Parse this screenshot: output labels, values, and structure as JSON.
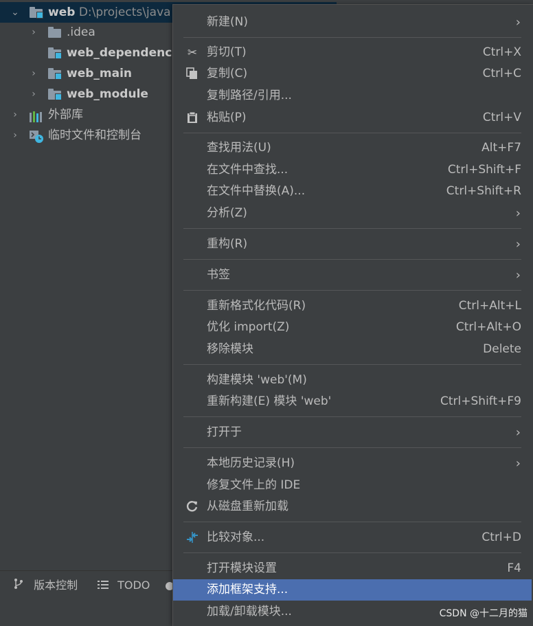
{
  "tree": {
    "root": {
      "name": "web",
      "path": "D:\\projects\\java"
    },
    "items": [
      {
        "label": ".idea"
      },
      {
        "label": "web_dependencie"
      },
      {
        "label": "web_main"
      },
      {
        "label": "web_module"
      },
      {
        "label": "外部库"
      },
      {
        "label": "临时文件和控制台"
      }
    ]
  },
  "bottombar": {
    "tabs": [
      {
        "label": "版本控制"
      },
      {
        "label": "TODO"
      }
    ]
  },
  "menu": {
    "items": [
      {
        "label": "新建(N)",
        "submenu": true
      },
      {
        "label": "剪切(T)",
        "shortcut": "Ctrl+X",
        "icon": "scissors-icon"
      },
      {
        "label": "复制(C)",
        "shortcut": "Ctrl+C",
        "icon": "copy-icon"
      },
      {
        "label": "复制路径/引用..."
      },
      {
        "label": "粘贴(P)",
        "shortcut": "Ctrl+V",
        "icon": "paste-icon"
      },
      {
        "label": "查找用法(U)",
        "shortcut": "Alt+F7"
      },
      {
        "label": "在文件中查找...",
        "shortcut": "Ctrl+Shift+F"
      },
      {
        "label": "在文件中替换(A)...",
        "shortcut": "Ctrl+Shift+R"
      },
      {
        "label": "分析(Z)",
        "submenu": true
      },
      {
        "label": "重构(R)",
        "submenu": true
      },
      {
        "label": "书签",
        "submenu": true
      },
      {
        "label": "重新格式化代码(R)",
        "shortcut": "Ctrl+Alt+L"
      },
      {
        "label": "优化 import(Z)",
        "shortcut": "Ctrl+Alt+O"
      },
      {
        "label": "移除模块",
        "shortcut": "Delete"
      },
      {
        "label": "构建模块 'web'(M)"
      },
      {
        "label": "重新构建(E) 模块 'web'",
        "shortcut": "Ctrl+Shift+F9"
      },
      {
        "label": "打开于",
        "submenu": true
      },
      {
        "label": "本地历史记录(H)",
        "submenu": true
      },
      {
        "label": "修复文件上的 IDE"
      },
      {
        "label": "从磁盘重新加载",
        "icon": "reload-icon"
      },
      {
        "label": "比较对象...",
        "shortcut": "Ctrl+D",
        "icon": "compare-icon"
      },
      {
        "label": "打开模块设置",
        "shortcut": "F4"
      },
      {
        "label": "添加框架支持...",
        "highlighted": true
      },
      {
        "label": "加载/卸载模块..."
      }
    ]
  },
  "watermark": "CSDN @十二月的猫",
  "colors": {
    "background": "#3c3f41",
    "highlight": "#4b6eaf",
    "selected_row": "#0d293e",
    "module_accent": "#40b6e0",
    "compare_icon": "#3592c4"
  }
}
